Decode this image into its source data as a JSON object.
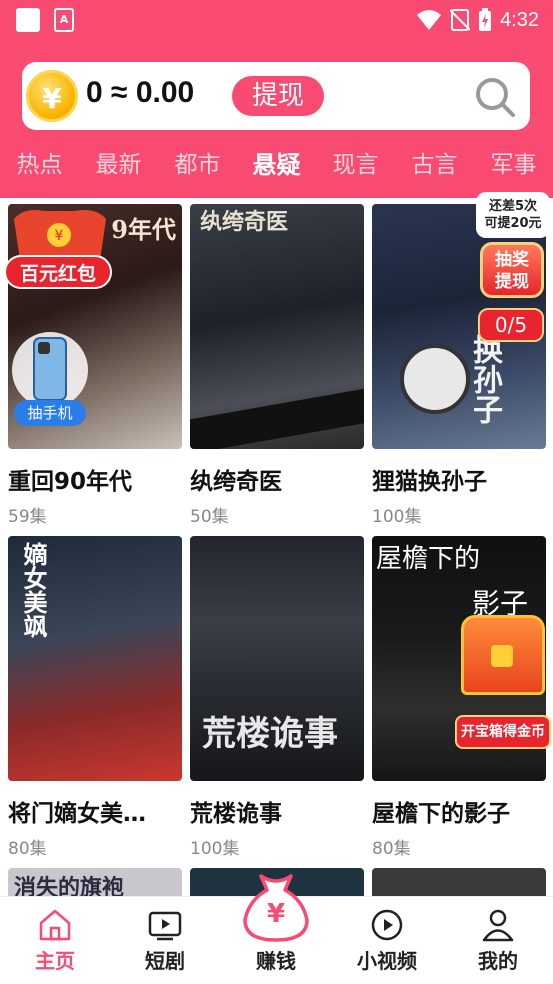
{
  "status_bar": {
    "time": "4:32"
  },
  "wallet": {
    "coin_symbol": "¥",
    "balance": "0 ≈ 0.00",
    "withdraw_label": "提现"
  },
  "category_tabs": [
    "热点",
    "最新",
    "都市",
    "悬疑",
    "现言",
    "古言",
    "军事"
  ],
  "active_tab": "悬疑",
  "dramas": [
    {
      "title": "重回90年代",
      "episodes": "59集",
      "poster_text": "9年代"
    },
    {
      "title": "纨绔奇医",
      "episodes": "50集",
      "poster_text": "纨绔奇医"
    },
    {
      "title": "狸猫换孙子",
      "episodes": "100集",
      "poster_text": "换孙子"
    },
    {
      "title": "将门嫡女美…",
      "episodes": "80集",
      "poster_text": "嫡女美飒"
    },
    {
      "title": "荒楼诡事",
      "episodes": "100集",
      "poster_text": "荒楼诡事"
    },
    {
      "title": "屋檐下的影子",
      "episodes": "80集",
      "poster_text_1": "屋檐下的",
      "poster_text_2": "影子"
    }
  ],
  "next_row_poster_text": "消失的旗袍",
  "promos": {
    "red_packet": "百元红包",
    "phone": "抽手机",
    "lottery_hint_1": "还差5次",
    "lottery_hint_2": "可提20元",
    "lottery_box_1": "抽奖",
    "lottery_box_2": "提现",
    "lottery_count": "0/5",
    "treasure_chest": "开宝箱得金币"
  },
  "bottom_nav": [
    {
      "label": "主页",
      "icon": "home-icon",
      "active": true
    },
    {
      "label": "短剧",
      "icon": "tv-icon",
      "active": false
    },
    {
      "label": "赚钱",
      "icon": "money-bag-icon",
      "active": false
    },
    {
      "label": "小视频",
      "icon": "play-circle-icon",
      "active": false
    },
    {
      "label": "我的",
      "icon": "person-icon",
      "active": false
    }
  ],
  "colors": {
    "brand": "#f94a72",
    "promo_red": "#e8242e",
    "coin_gold": "#f7b500"
  }
}
